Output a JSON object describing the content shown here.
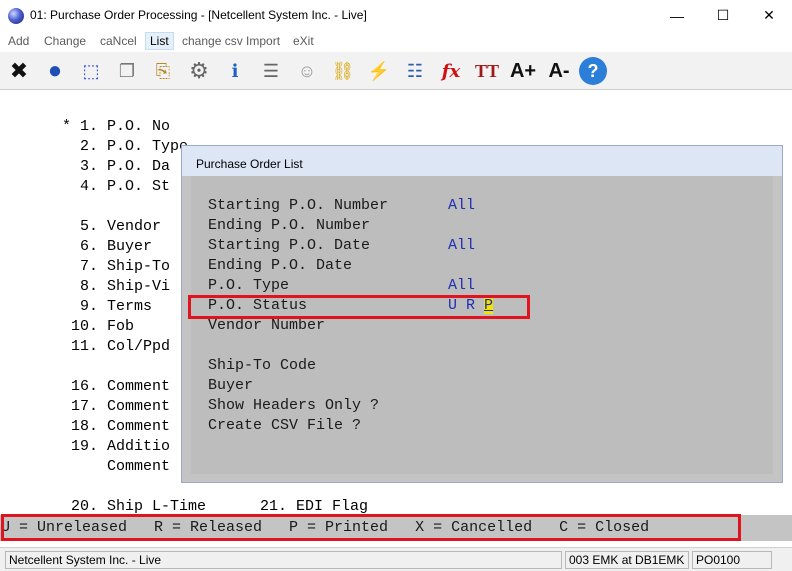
{
  "window": {
    "title": "01: Purchase Order Processing - [Netcellent System Inc. - Live]",
    "min_glyph": "—",
    "max_glyph": "☐",
    "close_glyph": "✕"
  },
  "menu": [
    "Add",
    "Change",
    "caNcel",
    "List",
    "change csv Import",
    "eXit"
  ],
  "menu_active": "List",
  "toolbar": [
    {
      "icon": "close-x-icon",
      "glyph": "✖"
    },
    {
      "icon": "globe-icon",
      "glyph": "●"
    },
    {
      "icon": "select-rect-icon",
      "glyph": "⬚"
    },
    {
      "icon": "copy-icon",
      "glyph": "❐"
    },
    {
      "icon": "paste-icon",
      "glyph": "⎘"
    },
    {
      "icon": "settings-gear-icon",
      "glyph": "⚙"
    },
    {
      "icon": "info-form-icon",
      "glyph": "ℹ"
    },
    {
      "icon": "list-icon",
      "glyph": "☰"
    },
    {
      "icon": "users-icon",
      "glyph": "☺"
    },
    {
      "icon": "link-icon",
      "glyph": "⛓"
    },
    {
      "icon": "lightning-icon",
      "glyph": "⚡"
    },
    {
      "icon": "report-icon",
      "glyph": "☷"
    },
    {
      "icon": "function-icon",
      "glyph": "fx"
    },
    {
      "icon": "text-size-icon",
      "glyph": "TT"
    },
    {
      "icon": "font-increase-icon",
      "glyph": "A+"
    },
    {
      "icon": "font-decrease-icon",
      "glyph": "A-"
    },
    {
      "icon": "help-icon",
      "glyph": "?"
    }
  ],
  "colors": {
    "highlight": "#e0141e",
    "value_blue": "#1f2fb3",
    "cursor": "#f2e400"
  },
  "form_lines": [
    "* 1. P.O. No",
    "  2. P.O. Type",
    "  3. P.O. Da",
    "  4. P.O. St",
    "  5. Vendor",
    "  6. Buyer",
    "  7. Ship-To",
    "  8. Ship-Vi",
    "  9. Terms",
    " 10. Fob",
    " 11. Col/Ppd",
    " 16. Comment",
    " 17. Comment",
    " 18. Comment",
    " 19. Additio",
    "     Comment",
    " 20. Ship L-Time      21. EDI Flag"
  ],
  "popup": {
    "title": "Purchase Order List",
    "fields": [
      {
        "label": "Starting P.O. Number",
        "value": "All"
      },
      {
        "label": "Ending P.O. Number",
        "value": ""
      },
      {
        "label": "Starting P.O. Date",
        "value": "All"
      },
      {
        "label": "Ending P.O. Date",
        "value": ""
      },
      {
        "label": "P.O. Type",
        "value": "All"
      },
      {
        "label": "P.O. Status",
        "value": "U R ",
        "cursor_char": "P"
      },
      {
        "label": "Vendor Number",
        "value": ""
      },
      {
        "label": "Ship-To Code",
        "value": ""
      },
      {
        "label": "Buyer",
        "value": ""
      },
      {
        "label": "Show Headers Only ?",
        "value": ""
      },
      {
        "label": "Create CSV File ?",
        "value": ""
      }
    ]
  },
  "legend": "U = Unreleased   R = Released   P = Printed   X = Cancelled   C = Closed",
  "status": {
    "company": "Netcellent System Inc. - Live",
    "user": "003 EMK at DB1EMK",
    "program": "PO0100"
  }
}
